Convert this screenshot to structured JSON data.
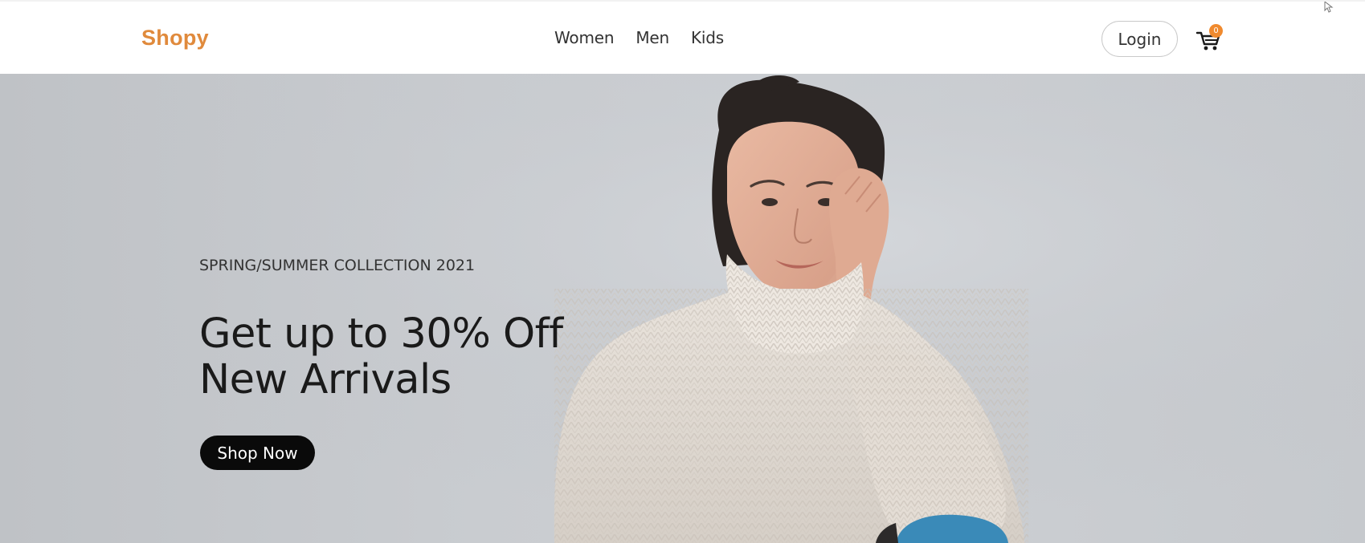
{
  "header": {
    "logo": "Shopy",
    "nav": [
      "Women",
      "Men",
      "Kids"
    ],
    "login_label": "Login",
    "cart_count": "0"
  },
  "hero": {
    "collection": "SPRING/SUMMER COLLECTION 2021",
    "headline_line1": "Get up to 30% Off",
    "headline_line2": "New Arrivals",
    "cta_label": "Shop Now"
  },
  "colors": {
    "brand": "#e08a3c",
    "badge": "#f08a2e",
    "cta_bg": "#0a0a0a"
  },
  "icons": {
    "cart": "shopping-cart-icon",
    "cursor": "mouse-cursor-icon"
  }
}
